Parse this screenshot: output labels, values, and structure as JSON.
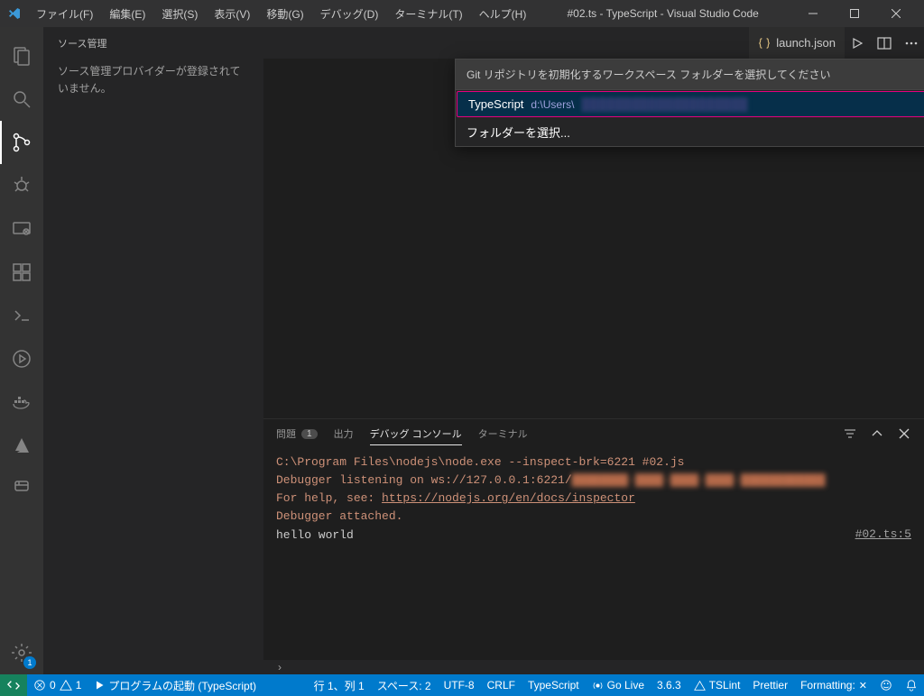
{
  "titlebar": {
    "menus": [
      "ファイル(F)",
      "編集(E)",
      "選択(S)",
      "表示(V)",
      "移動(G)",
      "デバッグ(D)",
      "ターミナル(T)",
      "ヘルプ(H)"
    ],
    "title": "#02.ts - TypeScript - Visual Studio Code"
  },
  "sidebar": {
    "title": "ソース管理",
    "message": "ソース管理プロバイダーが登録されていません。"
  },
  "activity": {
    "settings_badge": "1"
  },
  "tabs": {
    "open_tab": "launch.json"
  },
  "quickpick": {
    "header": "Git リポジトリを初期化するワークスペース フォルダーを選択してください",
    "item1_primary": "TypeScript",
    "item1_secondary": "d:\\Users\\",
    "item2": "フォルダーを選択..."
  },
  "panel": {
    "tabs": {
      "problems": "問題",
      "problems_badge": "1",
      "output": "出力",
      "debug_console": "デバッグ コンソール",
      "terminal": "ターミナル"
    },
    "lines": {
      "l1": "C:\\Program Files\\nodejs\\node.exe --inspect-brk=6221 #02.js",
      "l2a": "Debugger listening on ws://127.0.0.1:6221/",
      "l3a": "For help, see: ",
      "l3b": "https://nodejs.org/en/docs/inspector",
      "l4": "Debugger attached.",
      "l5": "hello world"
    },
    "source_link": "#02.ts:5"
  },
  "statusbar": {
    "errors": "0",
    "warnings": "1",
    "debug_target": "プログラムの起動 (TypeScript)",
    "ln_col": "行 1、列 1",
    "spaces": "スペース: 2",
    "encoding": "UTF-8",
    "eol": "CRLF",
    "lang": "TypeScript",
    "golive": "Go Live",
    "version": "3.6.3",
    "tslint": "TSLint",
    "prettier": "Prettier",
    "formatting": "Formatting:"
  }
}
